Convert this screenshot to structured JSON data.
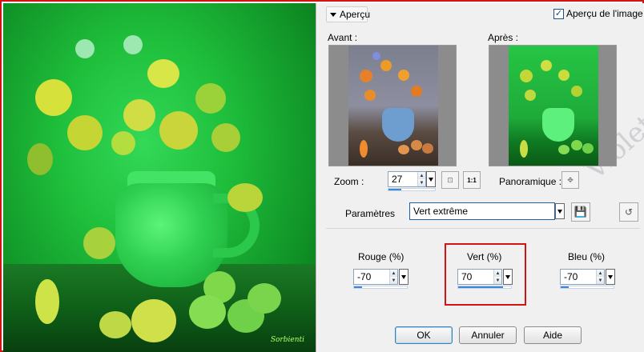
{
  "header": {
    "apercu_toggle_label": "Aperçu",
    "preview_checkbox_label": "Aperçu de l'image",
    "preview_checkbox_checked": true
  },
  "previews": {
    "before_label": "Avant :",
    "after_label": "Après :"
  },
  "zoom": {
    "label": "Zoom :",
    "value": "27",
    "actual_size_label": "1:1",
    "slider_fraction": 0.27
  },
  "pan": {
    "label": "Panoramique :"
  },
  "presets": {
    "label": "Paramètres",
    "selected": "Vert extrême"
  },
  "channels": [
    {
      "label": "Rouge (%)",
      "value": "-70",
      "slider_fraction": 0.15
    },
    {
      "label": "Vert (%)",
      "value": "70",
      "slider_fraction": 0.85
    },
    {
      "label": "Bleu (%)",
      "value": "-70",
      "slider_fraction": 0.15
    }
  ],
  "buttons": {
    "ok": "OK",
    "cancel": "Annuler",
    "help": "Aide"
  },
  "image": {
    "signature": "Sorbienti",
    "watermark": "Violette Graphic"
  },
  "colors": {
    "annotation_red": "#d21313",
    "slider_blue": "#3f87d6"
  }
}
